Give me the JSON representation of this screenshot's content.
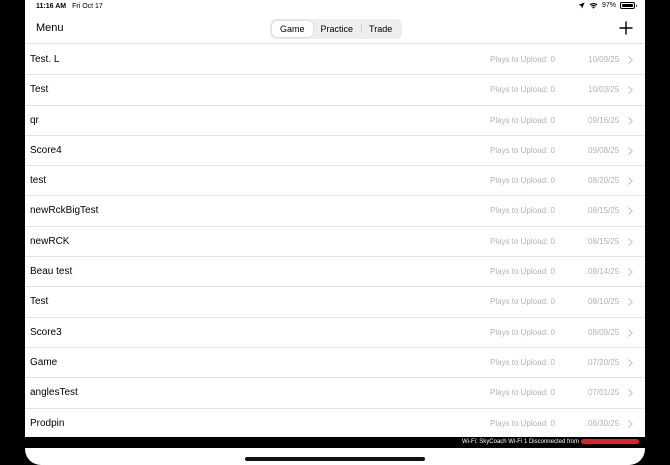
{
  "status_bar": {
    "time": "11:16 AM",
    "date": "Fri Oct 17",
    "battery": "97%",
    "battery_level": 0.97
  },
  "nav": {
    "menu_label": "Menu",
    "segments": [
      {
        "label": "Game",
        "active": true
      },
      {
        "label": "Practice",
        "active": false
      },
      {
        "label": "Trade",
        "active": false
      }
    ],
    "add_icon": "plus-icon"
  },
  "rows": [
    {
      "name": "Test. L",
      "plays": "Plays to Upload: 0",
      "date": "10/09/25"
    },
    {
      "name": "Test",
      "plays": "Plays to Upload: 0",
      "date": "10/03/25"
    },
    {
      "name": "qr",
      "plays": "Plays to Upload: 0",
      "date": "09/16/25"
    },
    {
      "name": "Score4",
      "plays": "Plays to Upload: 0",
      "date": "09/08/25"
    },
    {
      "name": "test",
      "plays": "Plays to Upload: 0",
      "date": "08/20/25"
    },
    {
      "name": "newRckBigTest",
      "plays": "Plays to Upload: 0",
      "date": "08/15/25"
    },
    {
      "name": "newRCK",
      "plays": "Plays to Upload: 0",
      "date": "08/15/25"
    },
    {
      "name": "Beau test",
      "plays": "Plays to Upload: 0",
      "date": "08/14/25"
    },
    {
      "name": "Test",
      "plays": "Plays to Upload: 0",
      "date": "08/10/25"
    },
    {
      "name": "Score3",
      "plays": "Plays to Upload: 0",
      "date": "08/09/25"
    },
    {
      "name": "Game",
      "plays": "Plays to Upload: 0",
      "date": "07/20/25"
    },
    {
      "name": "anglesTest",
      "plays": "Plays to Upload: 0",
      "date": "07/01/25"
    },
    {
      "name": "Prodpin",
      "plays": "Plays to Upload: 0",
      "date": "06/30/25"
    }
  ],
  "banner": {
    "text": "Wi-Fi: SkyCoach Wi-Fi 1   Disconnected from"
  },
  "colors": {
    "secondary_text": "#b3b3b7",
    "separator": "#e4e4e6",
    "redaction": "#e3202a"
  }
}
